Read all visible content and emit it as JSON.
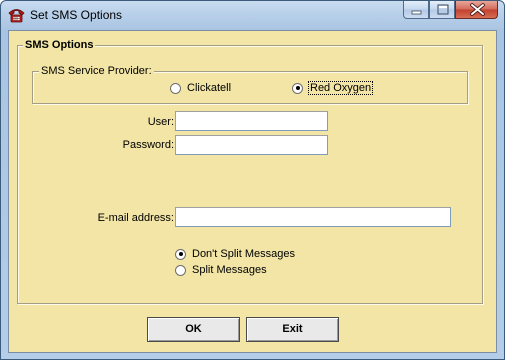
{
  "window": {
    "title": "Set SMS Options",
    "icon": "phone-app-icon",
    "caption_buttons": [
      "minimize",
      "maximize",
      "close"
    ]
  },
  "sms_options": {
    "group_label": "SMS Options",
    "provider": {
      "group_label": "SMS Service Provider:",
      "options": [
        {
          "label": "Clickatell",
          "selected": false
        },
        {
          "label": "Red Oxygen",
          "selected": true
        }
      ]
    },
    "user_label": "User:",
    "user_value": "",
    "password_label": "Password:",
    "password_value": "",
    "email_label": "E-mail address:",
    "email_value": "",
    "split_options": [
      {
        "label": "Don't Split Messages",
        "selected": true
      },
      {
        "label": "Split Messages",
        "selected": false
      }
    ]
  },
  "buttons": {
    "ok": "OK",
    "exit": "Exit"
  },
  "colors": {
    "client_background": "#f2e5a6",
    "frame": "#b4cde8",
    "close_button": "#c2402d"
  }
}
